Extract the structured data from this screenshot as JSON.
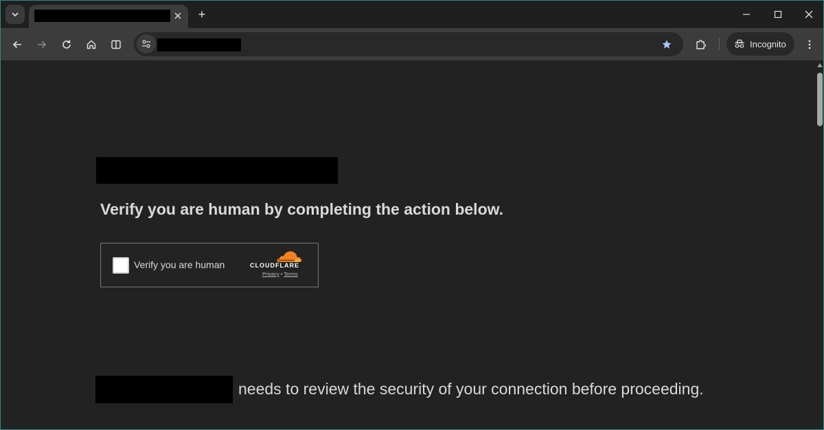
{
  "browser": {
    "tab": {
      "title": "",
      "close_icon": "close-icon"
    },
    "new_tab_label": "+",
    "toolbar": {
      "back_icon": "arrow-left-icon",
      "forward_icon": "arrow-right-icon",
      "reload_icon": "reload-icon",
      "home_icon": "home-icon",
      "split_icon": "split-view-icon",
      "url": "",
      "bookmark_icon": "star-icon",
      "extensions_icon": "puzzle-icon",
      "incognito_label": "Incognito",
      "menu_icon": "kebab-menu-icon"
    },
    "window_controls": [
      "minimize",
      "maximize",
      "close"
    ]
  },
  "page": {
    "site_name": "",
    "heading": "Verify you are human by completing the action below.",
    "challenge": {
      "checkbox_label": "Verify you are human",
      "brand": "CLOUDFLARE",
      "privacy_link": "Privacy",
      "separator": "•",
      "terms_link": "Terms",
      "brand_color": "#f48120"
    },
    "footer_text": "needs to review the security of your connection before proceeding."
  }
}
